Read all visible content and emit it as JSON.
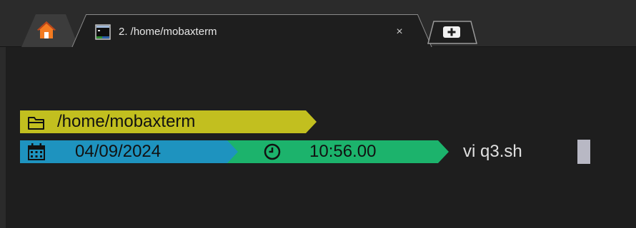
{
  "window": {
    "home_tab_icon": "home-icon",
    "new_tab_icon": "plus-icon"
  },
  "tabs": [
    {
      "label": "2. /home/mobaxterm",
      "icon": "terminal-session-icon",
      "close_label": "×",
      "active": true
    }
  ],
  "terminal": {
    "prompt": {
      "directory": "/home/mobaxterm",
      "directory_icon": "folder-icon",
      "date": "04/09/2024",
      "date_icon": "calendar-icon",
      "time": "10:56.00",
      "time_icon": "clock-icon"
    },
    "command": "vi q3.sh"
  },
  "colors": {
    "tabbar_background": "#2b2b2b",
    "terminal_background": "#1e1e1e",
    "directory_segment": "#c2bf1f",
    "date_segment": "#1e93bf",
    "time_segment": "#1cb36c",
    "home_icon_orange": "#f47b20",
    "cursor": "#b8b8c4"
  }
}
